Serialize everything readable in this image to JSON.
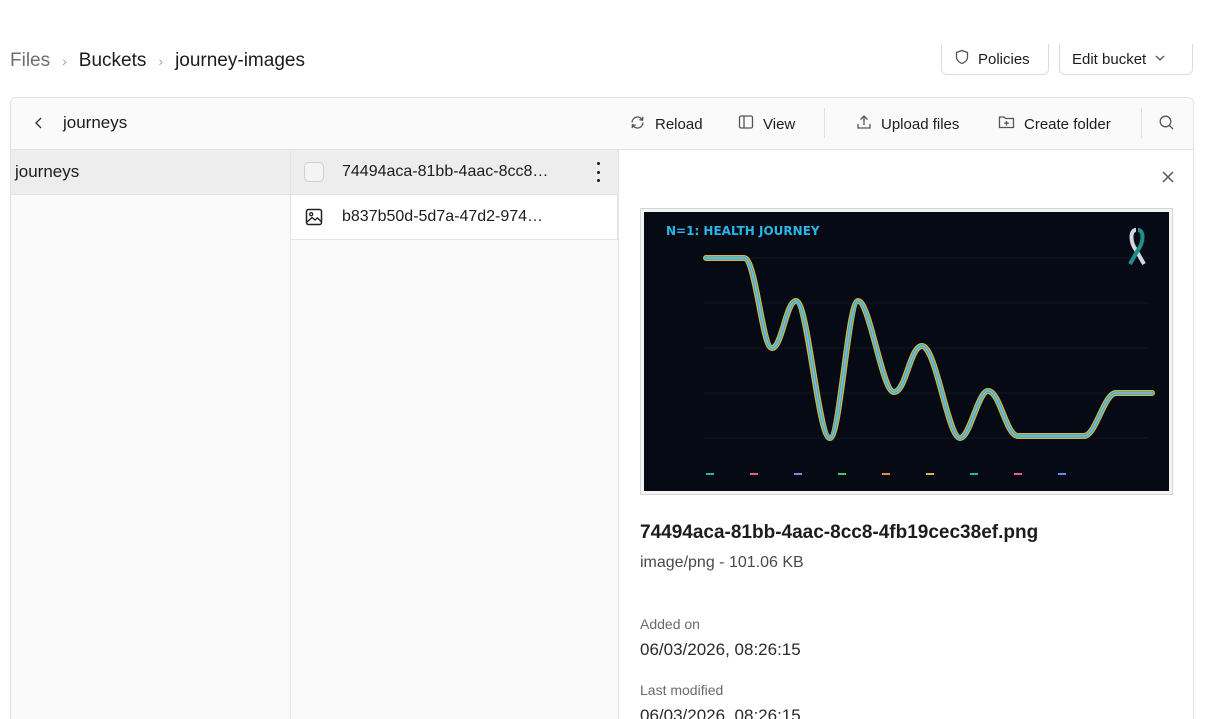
{
  "breadcrumb": {
    "root": "Files",
    "buckets": "Buckets",
    "bucket": "journey-images"
  },
  "header_actions": {
    "policies_label": "Policies",
    "edit_bucket_label": "Edit bucket"
  },
  "toolbar": {
    "current_folder": "journeys",
    "reload_label": "Reload",
    "view_label": "View",
    "upload_label": "Upload files",
    "create_folder_label": "Create folder"
  },
  "columns": {
    "folders": [
      {
        "name": "journeys",
        "selected": true
      }
    ],
    "files": [
      {
        "name": "74494aca-81bb-4aac-8cc8…",
        "type": "checkbox",
        "selected": true
      },
      {
        "name": "b837b50d-5d7a-47d2-974…",
        "type": "image",
        "selected": false
      }
    ]
  },
  "preview": {
    "image_title": "N=1: HEALTH JOURNEY",
    "file_name": "74494aca-81bb-4aac-8cc8-4fb19cec38ef.png",
    "file_meta": "image/png - 101.06 KB",
    "added_label": "Added on",
    "added_value": "06/03/2026, 08:26:15",
    "modified_label": "Last modified",
    "modified_value": "06/03/2026, 08:26:15"
  },
  "colors": {
    "preview_bg": "#050a14",
    "preview_title": "#29b6e8"
  }
}
